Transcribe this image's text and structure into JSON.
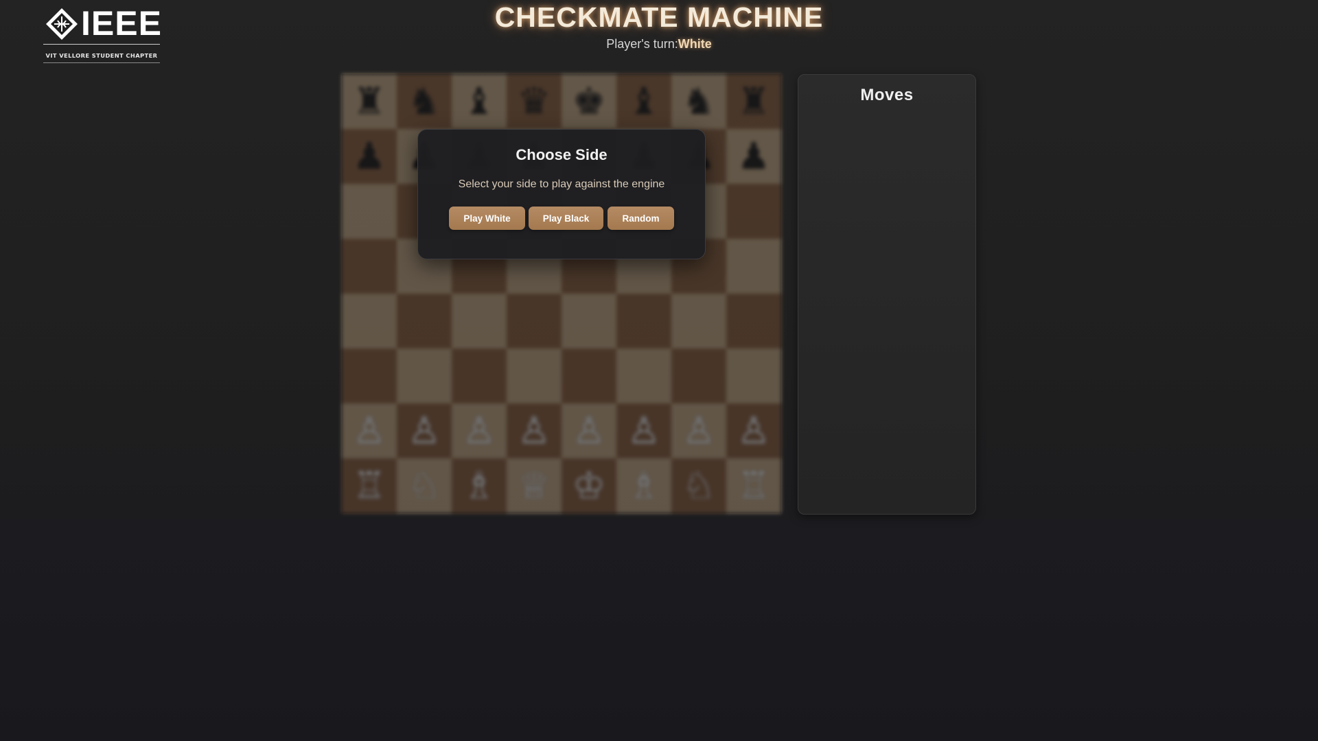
{
  "header": {
    "title": "CHECKMATE MACHINE",
    "turn_label": "Player's turn:",
    "turn_value": "White"
  },
  "logo": {
    "wordmark": "IEEE",
    "subtitle": "VIT VELLORE STUDENT CHAPTER"
  },
  "board": {
    "ranks": [
      [
        "♜",
        "♞",
        "♝",
        "♛",
        "♚",
        "♝",
        "♞",
        "♜"
      ],
      [
        "♟",
        "♟",
        "♟",
        "♟",
        "♟",
        "♟",
        "♟",
        "♟"
      ],
      [
        "",
        "",
        "",
        "",
        "",
        "",
        "",
        ""
      ],
      [
        "",
        "",
        "",
        "",
        "",
        "",
        "",
        ""
      ],
      [
        "",
        "",
        "",
        "",
        "",
        "",
        "",
        ""
      ],
      [
        "",
        "",
        "",
        "",
        "",
        "",
        "",
        ""
      ],
      [
        "♙",
        "♙",
        "♙",
        "♙",
        "♙",
        "♙",
        "♙",
        "♙"
      ],
      [
        "♖",
        "♘",
        "♗",
        "♕",
        "♔",
        "♗",
        "♘",
        "♖"
      ]
    ],
    "colors": {
      "light": "#c9ad86",
      "dark": "#8b5e3b"
    }
  },
  "moves_panel": {
    "title": "Moves",
    "moves": []
  },
  "modal": {
    "title": "Choose Side",
    "description": "Select your side to play against the engine",
    "buttons": {
      "white": "Play White",
      "black": "Play Black",
      "random": "Random"
    }
  },
  "colors": {
    "accent": "#a97f55",
    "title_glow": "#e8aa6e",
    "background": "#1f1f1f"
  }
}
